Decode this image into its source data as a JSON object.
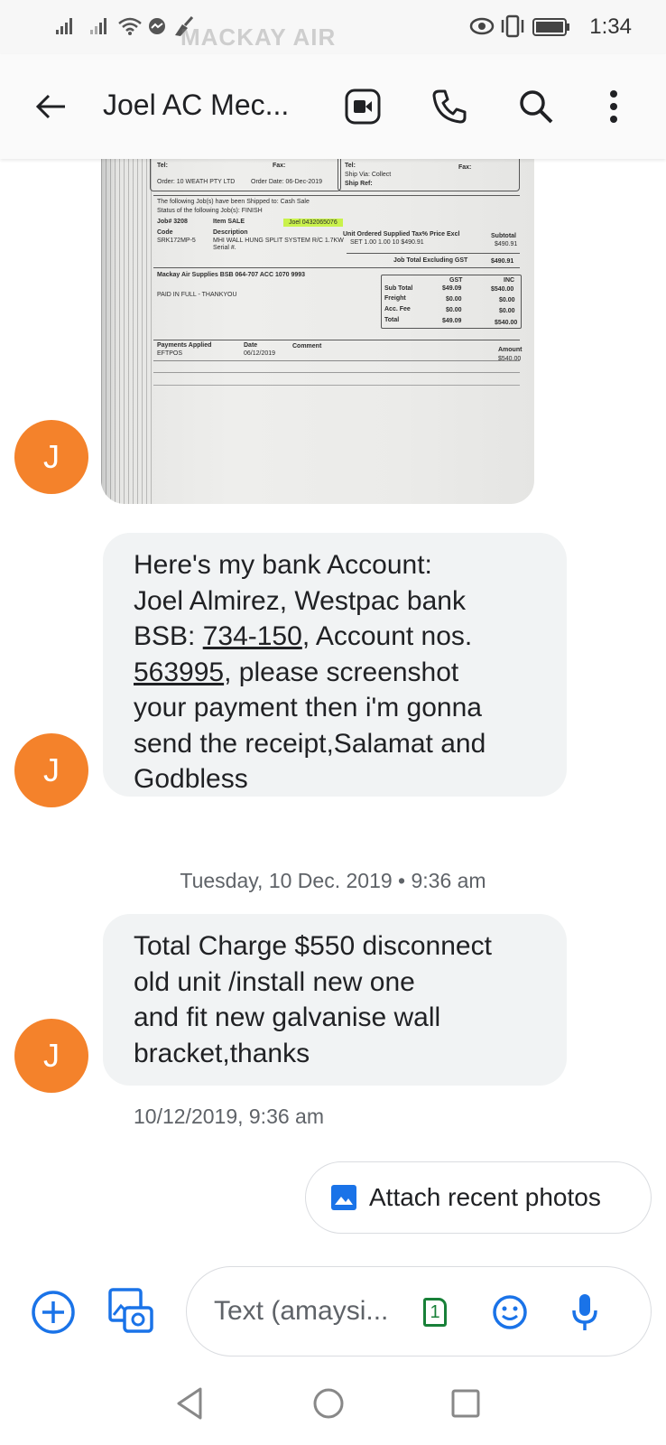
{
  "status_bar": {
    "time": "1:34"
  },
  "header": {
    "title": "Joel AC Mec..."
  },
  "receipt_image": {
    "watermark": "MACKAY AIR",
    "tel": "Tel:",
    "fax": "Fax:",
    "ship_via": "Ship Via: Collect",
    "ship_ref": "Ship Ref:",
    "order": "Order:   10 WEATH PTY LTD",
    "order_date": "Order Date: 06-Dec-2019",
    "shipped_note": "The following Job(s) have been Shipped to: Cash Sale",
    "status_note": "Status of the following Job(s): FINISH",
    "job": "Job# 3208",
    "item": "Item SALE",
    "highlight": "Joel 0432065076",
    "code_header": "Code",
    "code": "SRK172MP-5",
    "desc_header": "Description",
    "description": "MHI WALL HUNG SPLIT SYSTEM R/C 1.7KW",
    "serial": "Serial #.",
    "cols_header": "Unit  Ordered  Supplied  Tax%  Price Excl",
    "cols_values": "SET        1.00        1.00  10        $490.91",
    "subtotal_header": "Subtotal",
    "subtotal_value": "$490.91",
    "job_total_label": "Job Total Excluding GST",
    "job_total_value": "$490.91",
    "bank_line": "Mackay Air Supplies BSB 064-707 ACC 1070 9993",
    "paid": "PAID IN FULL - THANKYOU",
    "gst_header": "GST",
    "inc_header": "INC",
    "sub_total_label": "Sub Total",
    "sub_total_gst": "$49.09",
    "sub_total_inc": "$540.00",
    "freight_label": "Freight",
    "freight_gst": "$0.00",
    "freight_inc": "$0.00",
    "acc_label": "Acc. Fee",
    "acc_gst": "$0.00",
    "acc_inc": "$0.00",
    "total_label": "Total",
    "total_gst": "$49.09",
    "total_inc": "$540.00",
    "payments_applied": "Payments Applied",
    "eftpos": "EFTPOS",
    "date_header": "Date",
    "date_value": "06/12/2019",
    "comment_header": "Comment",
    "amount_header": "Amount",
    "amount_value": "$540.00"
  },
  "messages": [
    {
      "avatar": "J",
      "parts": {
        "a": "Here's my bank Account:",
        "b": "Joel Almirez, Westpac bank",
        "c_pre": "BSB: ",
        "c_link": "734-150",
        "c_post": ", Account nos.",
        "d_link": "563995",
        "d_post": ", please screenshot",
        "e": "your payment then i'm gonna",
        "f": "send the receipt,Salamat and",
        "g": "Godbless"
      }
    },
    {
      "avatar": "J",
      "lines": [
        "Total Charge $550 disconnect",
        "old unit /install new one",
        "and fit new galvanise wall",
        "bracket,thanks"
      ],
      "timestamp": "10/12/2019, 9:36 am"
    }
  ],
  "date_divider": "Tuesday, 10 Dec. 2019 • 9:36 am",
  "attach_chip": {
    "label": "Attach recent photos"
  },
  "compose": {
    "placeholder": "Text (amaysi...",
    "sim_number": "1"
  },
  "colors": {
    "accent": "#1a73e8",
    "avatar": "#f4822b",
    "bubble": "#f1f3f4",
    "sim": "#188038"
  }
}
